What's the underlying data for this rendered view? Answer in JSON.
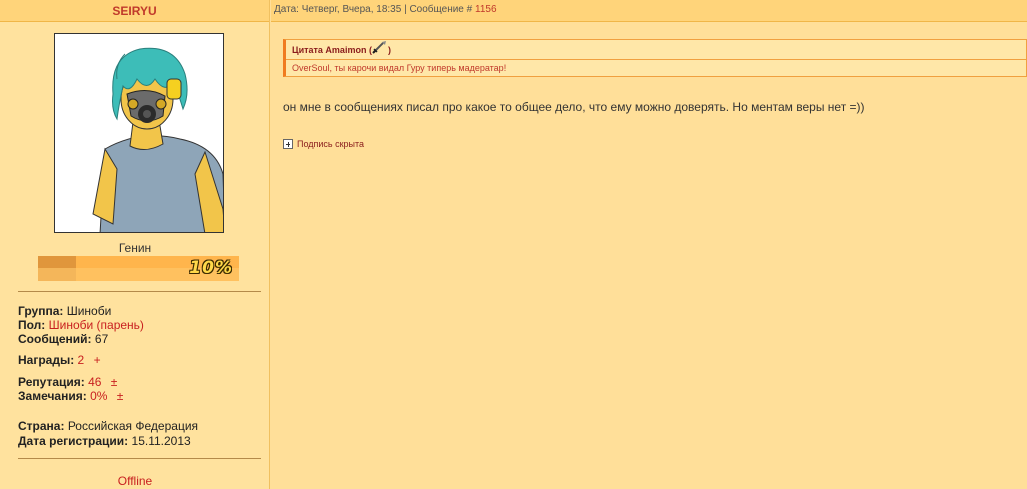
{
  "user": {
    "name": "SEIRYU",
    "rank": "Генин",
    "progress_label": "10%",
    "progress": 0.19,
    "group_label": "Группа:",
    "group_value": "Шиноби",
    "gender_label": "Пол:",
    "gender_value": "Шиноби (парень)",
    "posts_label": "Сообщений:",
    "posts_value": "67",
    "awards_label": "Награды:",
    "awards_value": "2",
    "awards_action": "+",
    "rep_label": "Репутация:",
    "rep_value": "46",
    "rep_action": "±",
    "warn_label": "Замечания:",
    "warn_value": "0%",
    "warn_action": "±",
    "country_label": "Страна:",
    "country_value": "Российская Федерация",
    "reg_label": "Дата регистрации:",
    "reg_value": "15.11.2013",
    "status": "Offline"
  },
  "post": {
    "meta": "Дата: Четверг, Вчера, 18:35 | Сообщение #",
    "number": "1156",
    "quote_header": "Цитата Amaimon (",
    "quote_header_end": ")",
    "quote_text": "OverSoul, ты карочи видал Гуру типерь мадератар!",
    "message": "он мне в сообщениях писал про какое то общее дело, что ему можно доверять. Но ментам веры нет =))",
    "signature_toggle": "Подпись скрыта"
  },
  "colors": {
    "background": "#ffdf99",
    "header": "#ffd47a",
    "accent_red": "#c82020",
    "quote_border": "#f07b20"
  }
}
